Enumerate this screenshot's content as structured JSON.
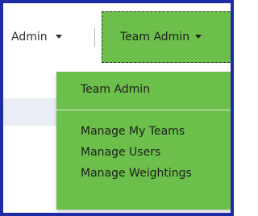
{
  "navbar": {
    "admin_label": "Admin",
    "team_admin_label": "Team Admin"
  },
  "dropdown": {
    "items": [
      {
        "label": "Team Admin"
      },
      {
        "label": "Manage My Teams"
      },
      {
        "label": "Manage Users"
      },
      {
        "label": "Manage Weightings"
      }
    ]
  },
  "colors": {
    "frame_border": "#1f2ba5",
    "menu_background": "#6cbf4a",
    "menu_divider": "#dcebd3",
    "page_background": "#ffffff",
    "content_strip": "#e8edf6"
  },
  "icons": {
    "caret": "chevron-down-icon"
  }
}
